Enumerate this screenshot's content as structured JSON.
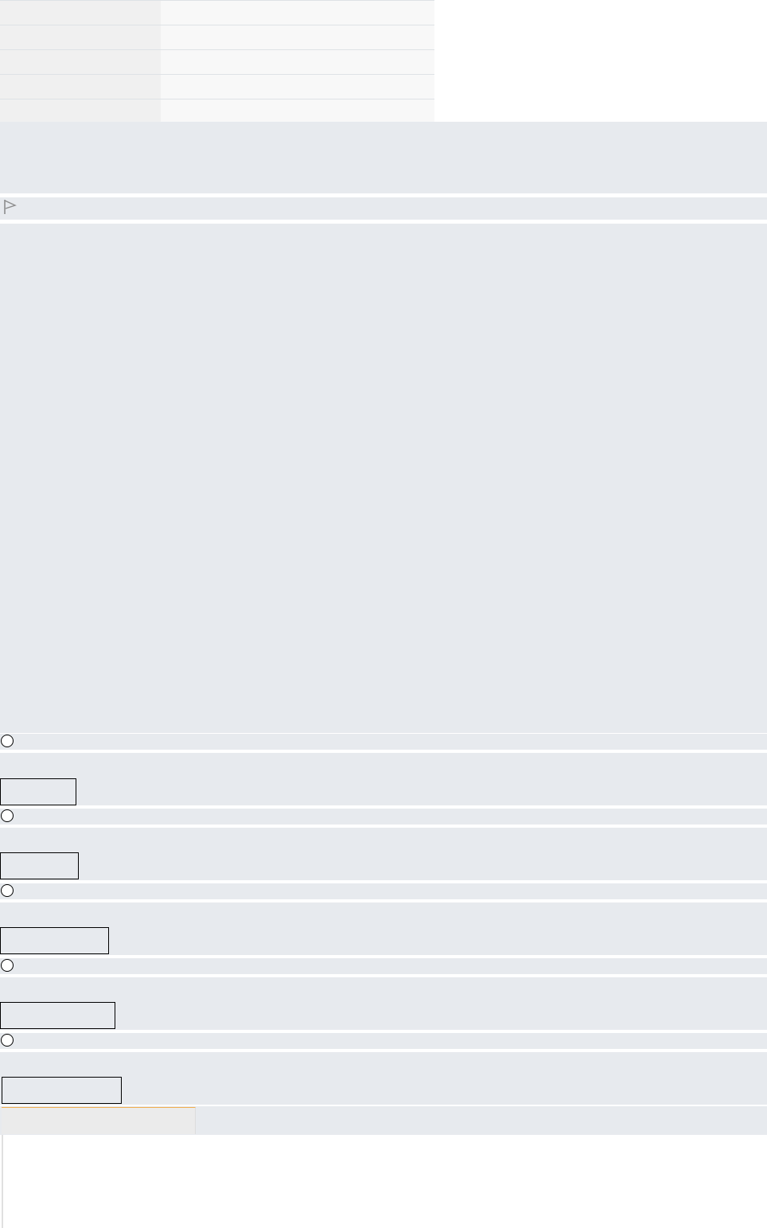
{
  "summary": {
    "rows": [
      {
        "label": "",
        "value": ""
      },
      {
        "label": "",
        "value": ""
      },
      {
        "label": "",
        "value": ""
      },
      {
        "label": "",
        "value": ""
      },
      {
        "label": "",
        "value": ""
      }
    ]
  },
  "question": {
    "info_text": "",
    "flag_label": "",
    "question_text": "",
    "answers": [
      {
        "label": ""
      },
      {
        "label": ""
      },
      {
        "label": ""
      },
      {
        "label": ""
      },
      {
        "label": ""
      }
    ]
  },
  "navigation": {
    "tab_label": ""
  },
  "icons": {
    "flag": "flag-icon",
    "radio": "radio-button"
  }
}
